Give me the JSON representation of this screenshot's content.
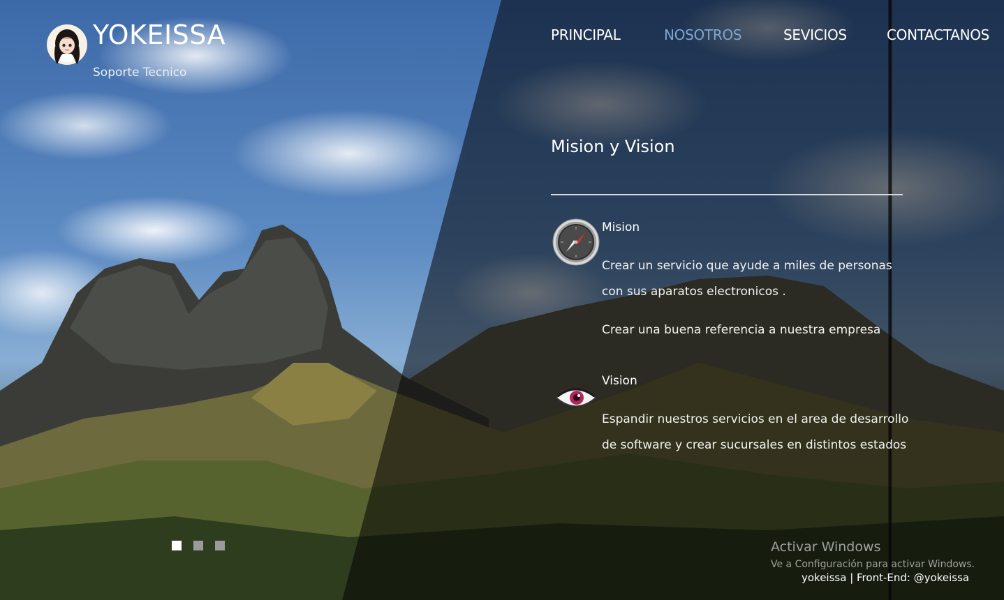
{
  "header": {
    "brand_title": "YOKEISSA",
    "brand_subtitle": "Soporte Tecnico"
  },
  "nav": {
    "items": [
      {
        "label": "PRINCIPAL",
        "active": false
      },
      {
        "label": "NOSOTROS",
        "active": true
      },
      {
        "label": "SEVICIOS",
        "active": false
      },
      {
        "label": "CONTACTANOS",
        "active": false
      }
    ],
    "active_color": "#7fa6cf"
  },
  "main": {
    "section_title": "Mision y Vision",
    "mision": {
      "icon": "compass-icon",
      "heading": "Mision",
      "paragraphs": [
        "Crear un servicio que ayude a miles de personas con sus aparatos electronicos .",
        "Crear una buena referencia a nuestra empresa"
      ]
    },
    "vision": {
      "icon": "eye-icon",
      "heading": "Vision",
      "paragraphs": [
        "Espandir nuestros servicios en el area de desarrollo de software y crear sucursales en distintos estados"
      ]
    }
  },
  "slider": {
    "dot_count": 3,
    "active_index": 0
  },
  "watermark": {
    "title": "Activar Windows",
    "subtitle": "Ve a Configuración para activar Windows."
  },
  "footer": {
    "credit": "yokeissa | Front-End: @yokeissa"
  }
}
